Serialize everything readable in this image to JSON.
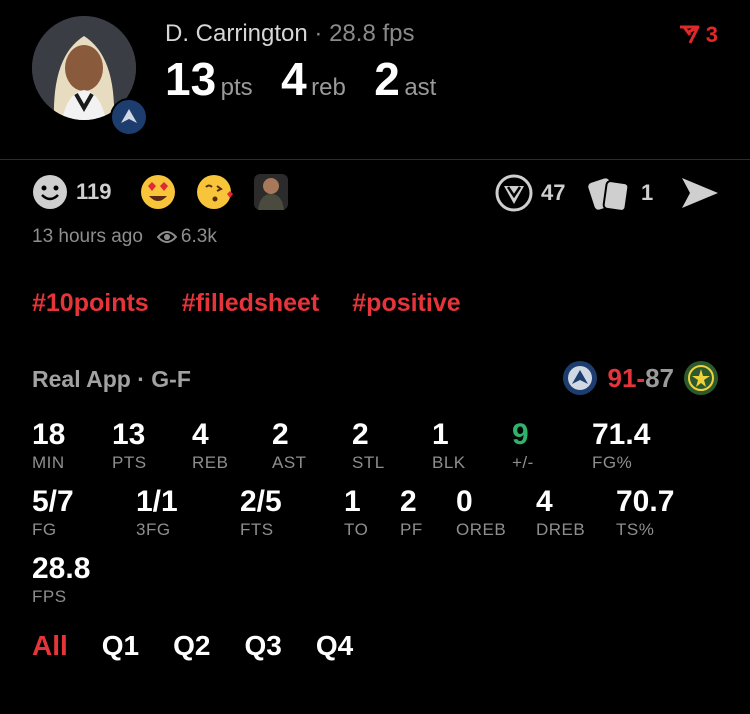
{
  "player": {
    "name": "D. Carrington",
    "separator": "·",
    "fps_label": "28.8 fps",
    "points": "13",
    "points_unit": "pts",
    "rebounds": "4",
    "rebounds_unit": "reb",
    "assists": "2",
    "assists_unit": "ast"
  },
  "flag": {
    "count": "3",
    "color": "#e02a2a",
    "icon": "red-flag-icon"
  },
  "reactions": {
    "smile_count": "119",
    "verify_count": "47",
    "cards_count": "1",
    "icons": [
      "smile-icon",
      "heart-eyes-emoji-icon",
      "kiss-emoji-icon",
      "sticker-face-icon",
      "verify-badge-icon",
      "cards-icon",
      "send-icon"
    ]
  },
  "meta": {
    "time_ago": "13 hours ago",
    "views": "6.3k"
  },
  "hashtags": [
    "#10points",
    "#filledsheet",
    "#positive"
  ],
  "game": {
    "label": "Real App · G-F",
    "home_score": "91",
    "score_sep": "-",
    "away_score": "87",
    "win_color": "#e5343a"
  },
  "stats_row1": [
    {
      "value": "18",
      "label": "MIN"
    },
    {
      "value": "13",
      "label": "PTS"
    },
    {
      "value": "4",
      "label": "REB"
    },
    {
      "value": "2",
      "label": "AST"
    },
    {
      "value": "2",
      "label": "STL"
    },
    {
      "value": "1",
      "label": "BLK"
    },
    {
      "value": "9",
      "label": "+/-"
    },
    {
      "value": "71.4",
      "label": "FG%"
    }
  ],
  "stats_row2": [
    {
      "value": "5/7",
      "label": "FG"
    },
    {
      "value": "1/1",
      "label": "3FG"
    },
    {
      "value": "2/5",
      "label": "FTS"
    },
    {
      "value": "1",
      "label": "TO"
    },
    {
      "value": "2",
      "label": "PF"
    },
    {
      "value": "0",
      "label": "OREB"
    },
    {
      "value": "4",
      "label": "DREB"
    },
    {
      "value": "70.7",
      "label": "TS%"
    }
  ],
  "stats_row3": [
    {
      "value": "28.8",
      "label": "FPS"
    }
  ],
  "plus_minus_color": "#2fb36b",
  "tabs": [
    "All",
    "Q1",
    "Q2",
    "Q3",
    "Q4"
  ]
}
